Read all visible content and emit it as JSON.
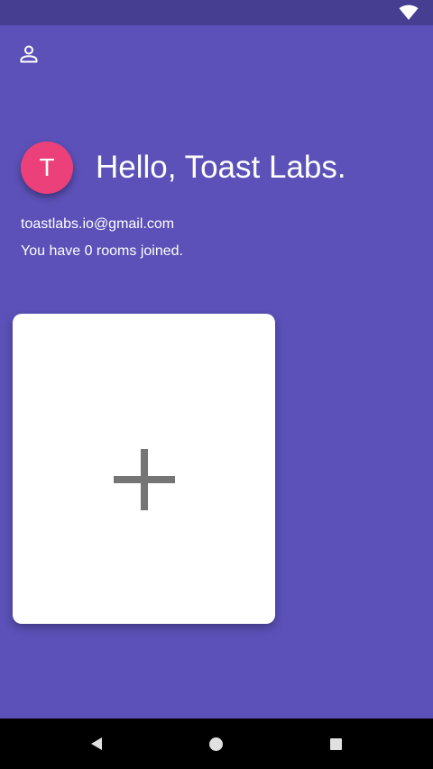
{
  "status_bar": {
    "icons": [
      "wifi-icon"
    ]
  },
  "header": {
    "profile_icon": "person-outline-icon"
  },
  "user": {
    "avatar_letter": "T",
    "avatar_color": "#ec407a",
    "greeting": "Hello, Toast Labs.",
    "email": "toastlabs.io@gmail.com",
    "rooms_summary": "You have 0 rooms joined."
  },
  "rooms": {
    "add_icon": "plus-icon"
  },
  "colors": {
    "status_bar": "#463e91",
    "background": "#5b51b8",
    "card": "#ffffff",
    "plus": "#757575",
    "nav_bar": "#000000"
  },
  "nav_bar": {
    "buttons": [
      "back-icon",
      "home-icon",
      "recents-icon"
    ]
  }
}
